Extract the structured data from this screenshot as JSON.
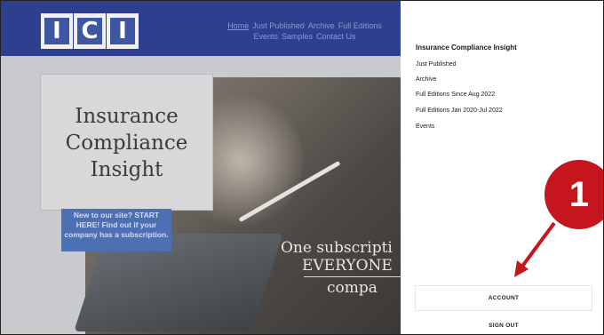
{
  "site": {
    "logo_letters": [
      "I",
      "C",
      "I"
    ],
    "nav": {
      "items": [
        "Home",
        "Just Published",
        "Archive",
        "Full Editions",
        "Events",
        "Samples",
        "Contact Us"
      ]
    },
    "hero": {
      "title": "Insurance Compliance Insight",
      "start_box": "New to our site? START HERE! Find out if your company has a subscription.",
      "tagline_line1": "One subscripti",
      "tagline_line2": "EVERYONE",
      "tagline_line3": "compa"
    }
  },
  "menu_panel": {
    "title": "Insurance Compliance Insight",
    "links": [
      "Just Published",
      "Archive",
      "Full Editions Since Aug 2022",
      "Full Editions Jan 2020-Jul 2022",
      "Events"
    ],
    "account_label": "ACCOUNT",
    "signout_label": "SIGN OUT"
  },
  "annotation": {
    "number": "1",
    "color": "#c4161c"
  },
  "colors": {
    "header": "#2e3f8f",
    "logo_blue": "#3f56a3",
    "start_box": "#4d6fb4"
  }
}
